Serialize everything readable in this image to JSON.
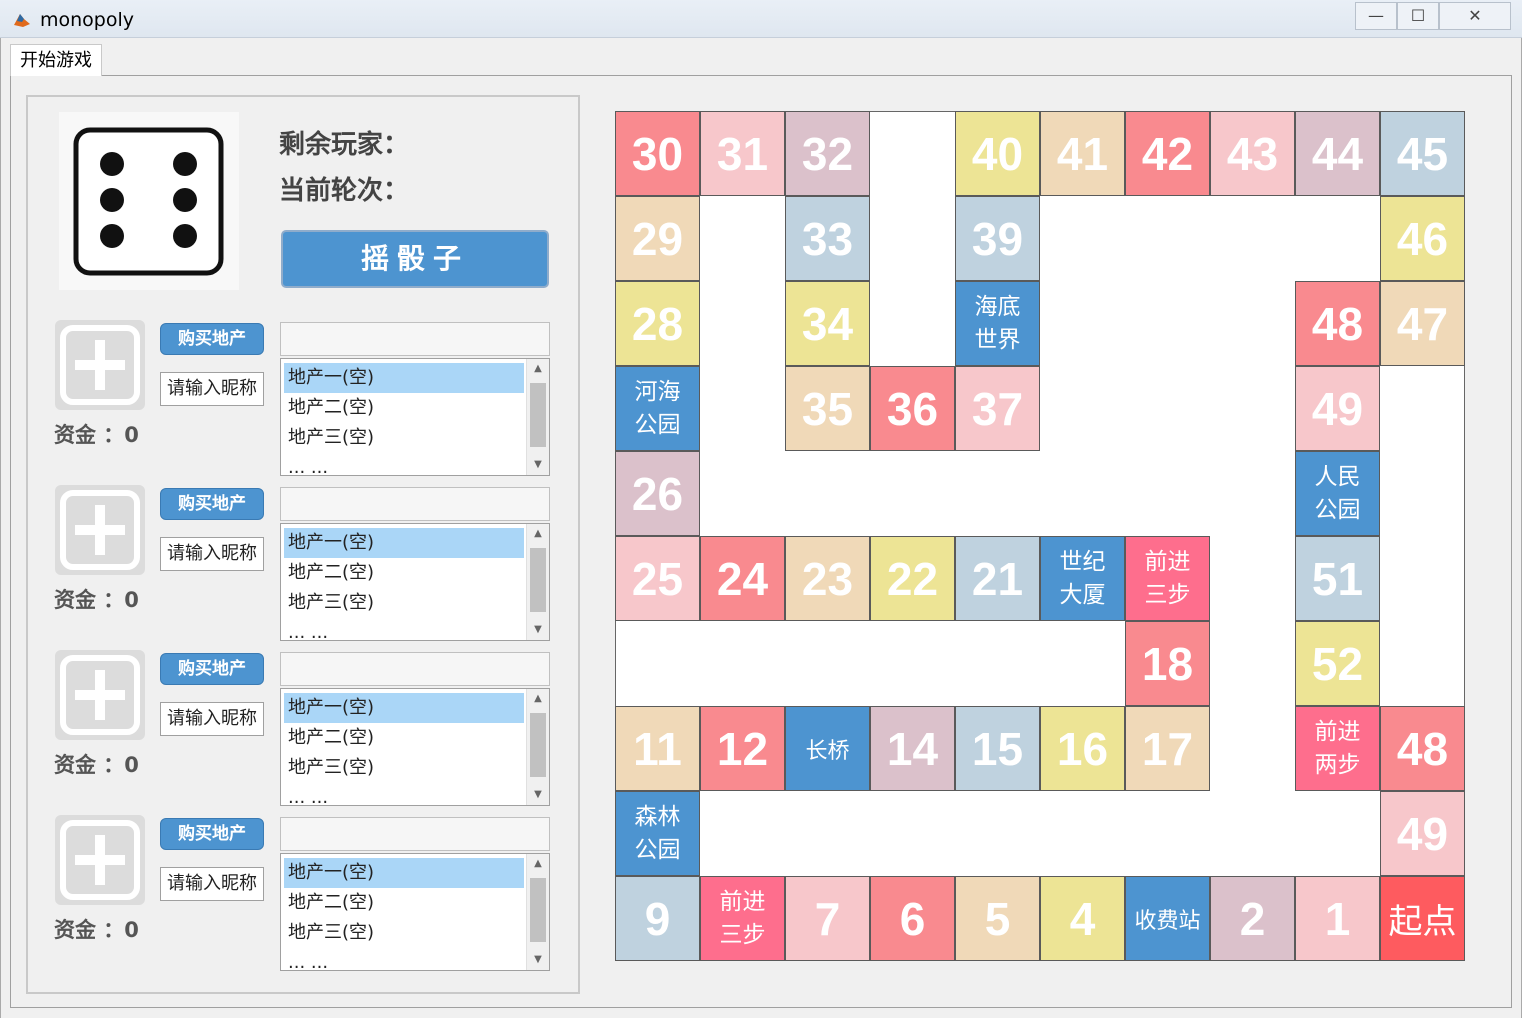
{
  "window": {
    "title": "monopoly",
    "controls": [
      "—",
      "☐",
      "✕"
    ]
  },
  "menu": {
    "start_game": "开始游戏"
  },
  "info": {
    "remaining_players": "剩余玩家：",
    "current_round": "当前轮次：",
    "roll_button": "摇骰子"
  },
  "dice": {
    "value": 6
  },
  "players": [
    {
      "buy": "购买地产",
      "nickname": "请输入昵称",
      "funds": "资金 ：0",
      "props": [
        "地产一(空)",
        "地产二(空)",
        "地产三(空)",
        "... ..."
      ]
    },
    {
      "buy": "购买地产",
      "nickname": "请输入昵称",
      "funds": "资金 ：0",
      "props": [
        "地产一(空)",
        "地产二(空)",
        "地产三(空)",
        "... ..."
      ]
    },
    {
      "buy": "购买地产",
      "nickname": "请输入昵称",
      "funds": "资金 ：0",
      "props": [
        "地产一(空)",
        "地产二(空)",
        "地产三(空)",
        "... ..."
      ]
    },
    {
      "buy": "购买地产",
      "nickname": "请输入昵称",
      "funds": "资金 ：0",
      "props": [
        "地产一(空)",
        "地产二(空)",
        "地产三(空)",
        "... ..."
      ]
    }
  ],
  "colors": {
    "red": "#f98a8f",
    "pink": "#f7c7cb",
    "mauve": "#dbc1cb",
    "beige": "#f0d9b8",
    "yellow": "#ede495",
    "blue": "#bfd2df",
    "accent": "#4d94d0",
    "hot": "#fe6e8d",
    "start": "#fe5b5f"
  },
  "board": [
    {
      "t": "30",
      "c": "red"
    },
    {
      "t": "31",
      "c": "pink"
    },
    {
      "t": "32",
      "c": "mauve"
    },
    {
      "t": "40",
      "c": "yellow"
    },
    {
      "t": "41",
      "c": "beige"
    },
    {
      "t": "42",
      "c": "red"
    },
    {
      "t": "43",
      "c": "pink"
    },
    {
      "t": "44",
      "c": "mauve"
    },
    {
      "t": "45",
      "c": "blue"
    },
    {
      "t": "29",
      "c": "beige"
    },
    {
      "t": "33",
      "c": "blue"
    },
    {
      "t": "39",
      "c": "blue"
    },
    {
      "t": "46",
      "c": "yellow"
    },
    {
      "t": "28",
      "c": "yellow"
    },
    {
      "t": "34",
      "c": "yellow"
    },
    {
      "t": "海底\n世界",
      "c": "accent"
    },
    {
      "t": "48",
      "c": "red"
    },
    {
      "t": "47",
      "c": "beige"
    },
    {
      "t": "河海\n公园",
      "c": "accent"
    },
    {
      "t": "35",
      "c": "beige"
    },
    {
      "t": "36",
      "c": "red"
    },
    {
      "t": "37",
      "c": "pink"
    },
    {
      "t": "49",
      "c": "pink"
    },
    {
      "t": "26",
      "c": "mauve"
    },
    {
      "t": "人民\n公园",
      "c": "accent"
    },
    {
      "t": "25",
      "c": "pink"
    },
    {
      "t": "24",
      "c": "red"
    },
    {
      "t": "23",
      "c": "beige"
    },
    {
      "t": "22",
      "c": "yellow"
    },
    {
      "t": "21",
      "c": "blue"
    },
    {
      "t": "世纪\n大厦",
      "c": "accent"
    },
    {
      "t": "前进\n三步",
      "c": "hot"
    },
    {
      "t": "51",
      "c": "blue"
    },
    {
      "t": "18",
      "c": "red"
    },
    {
      "t": "52",
      "c": "yellow"
    },
    {
      "t": "11",
      "c": "beige"
    },
    {
      "t": "12",
      "c": "red"
    },
    {
      "t": "长桥",
      "c": "accent"
    },
    {
      "t": "14",
      "c": "mauve"
    },
    {
      "t": "15",
      "c": "blue"
    },
    {
      "t": "16",
      "c": "yellow"
    },
    {
      "t": "17",
      "c": "beige"
    },
    {
      "t": "前进\n两步",
      "c": "hot"
    },
    {
      "t": "48",
      "c": "red"
    },
    {
      "t": "森林\n公园",
      "c": "accent"
    },
    {
      "t": "49",
      "c": "pink"
    },
    {
      "t": "9",
      "c": "blue"
    },
    {
      "t": "前进\n三步",
      "c": "hot"
    },
    {
      "t": "7",
      "c": "pink"
    },
    {
      "t": "6",
      "c": "red"
    },
    {
      "t": "5",
      "c": "beige"
    },
    {
      "t": "4",
      "c": "yellow"
    },
    {
      "t": "收费站",
      "c": "accent"
    },
    {
      "t": "2",
      "c": "mauve"
    },
    {
      "t": "1",
      "c": "pink"
    },
    {
      "t": "起点",
      "c": "start"
    }
  ]
}
